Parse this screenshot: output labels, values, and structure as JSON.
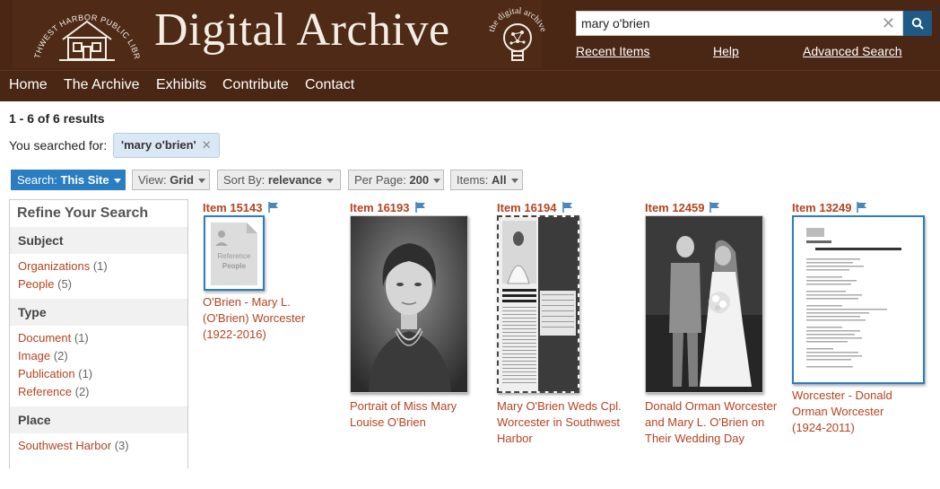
{
  "header": {
    "library_seal_text": "SOUTHWEST HARBOR PUBLIC LIBRARY",
    "title": "Digital Archive",
    "bulb_text": "the digital archive",
    "search_value": "mary o'brien",
    "links": [
      "Recent Items",
      "Help",
      "Advanced Search"
    ]
  },
  "nav": [
    "Home",
    "The Archive",
    "Exhibits",
    "Contribute",
    "Contact"
  ],
  "results": {
    "count_text": "1 - 6 of 6 results",
    "searched_label": "You searched for:",
    "search_term": "'mary o'brien'"
  },
  "toolbar": {
    "search": {
      "label": "Search:",
      "value": "This Site"
    },
    "view": {
      "label": "View:",
      "value": "Grid"
    },
    "sort": {
      "label": "Sort By:",
      "value": "relevance"
    },
    "per_page": {
      "label": "Per Page:",
      "value": "200"
    },
    "items": {
      "label": "Items:",
      "value": "All"
    }
  },
  "sidebar": {
    "title": "Refine Your Search",
    "sections": [
      {
        "heading": "Subject",
        "items": [
          {
            "label": "Organizations",
            "count": "(1)"
          },
          {
            "label": "People",
            "count": "(5)"
          }
        ]
      },
      {
        "heading": "Type",
        "items": [
          {
            "label": "Document",
            "count": "(1)"
          },
          {
            "label": "Image",
            "count": "(2)"
          },
          {
            "label": "Publication",
            "count": "(1)"
          },
          {
            "label": "Reference",
            "count": "(2)"
          }
        ]
      },
      {
        "heading": "Place",
        "items": [
          {
            "label": "Southwest Harbor",
            "count": "(3)"
          }
        ]
      }
    ]
  },
  "items": [
    {
      "id": "Item 15143",
      "thumb_text": [
        "Reference",
        "People"
      ],
      "caption": [
        "O'Brien - Mary L.",
        "(O'Brien) Worcester",
        "(1922-2016)"
      ]
    },
    {
      "id": "Item 16193",
      "caption": [
        "Portrait of Miss Mary",
        "Louise O'Brien"
      ]
    },
    {
      "id": "Item 16194",
      "caption": [
        "Mary O'Brien Weds Cpl.",
        "Worcester in Southwest",
        "Harbor"
      ]
    },
    {
      "id": "Item 12459",
      "caption": [
        "Donald Orman Worcester",
        "and Mary L. O'Brien on",
        "Their Wedding Day"
      ]
    },
    {
      "id": "Item 13249",
      "caption": [
        "Worcester - Donald",
        "Orman Worcester",
        "(1924-2011)"
      ]
    }
  ],
  "colors": {
    "header_bg": "#4a2615",
    "link": "#b5431f",
    "accent": "#2a7dc0",
    "search_button": "#1e5a85"
  }
}
